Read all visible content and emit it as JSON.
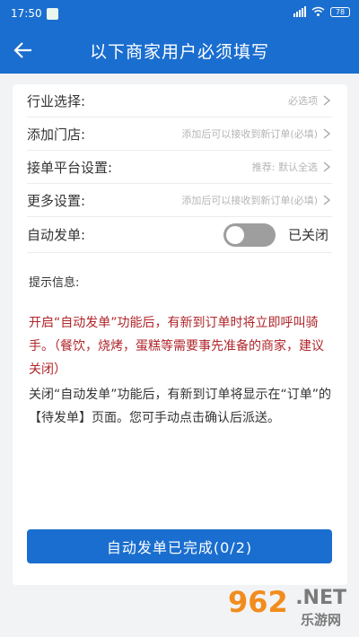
{
  "status_bar": {
    "time": "17:50",
    "battery": "78"
  },
  "header": {
    "title": "以下商家用户必须填写"
  },
  "settings": {
    "rows": [
      {
        "label": "行业选择:",
        "value": "必选项"
      },
      {
        "label": "添加门店:",
        "value": "添加后可以接收到新订单(必填)"
      },
      {
        "label": "接单平台设置:",
        "value": "推荐: 默认全选"
      },
      {
        "label": "更多设置:",
        "value": "添加后可以接收到新订单(必填)"
      }
    ],
    "auto_dispatch": {
      "label": "自动发单:",
      "status": "已关闭",
      "enabled": false
    }
  },
  "hints": {
    "title": "提示信息:",
    "red_text": "开启“自动发单”功能后，有新到订单时将立即呼叫骑手。（餐饮，烧烤，蛋糕等需要事先准备的商家，建议关闭）",
    "black_text": "关闭“自动发单”功能后，有新到订单将显示在“订单”的【待发单】页面。您可手动点击确认后派送。"
  },
  "footer": {
    "button_label": "自动发单已完成(0/2)"
  },
  "watermark": {
    "logo": "962",
    "suffix": ".NET",
    "site": "乐游网"
  },
  "colors": {
    "primary": "#1a6ecf",
    "warning_text": "#b0252a",
    "toggle_off": "#9e9e9e"
  }
}
